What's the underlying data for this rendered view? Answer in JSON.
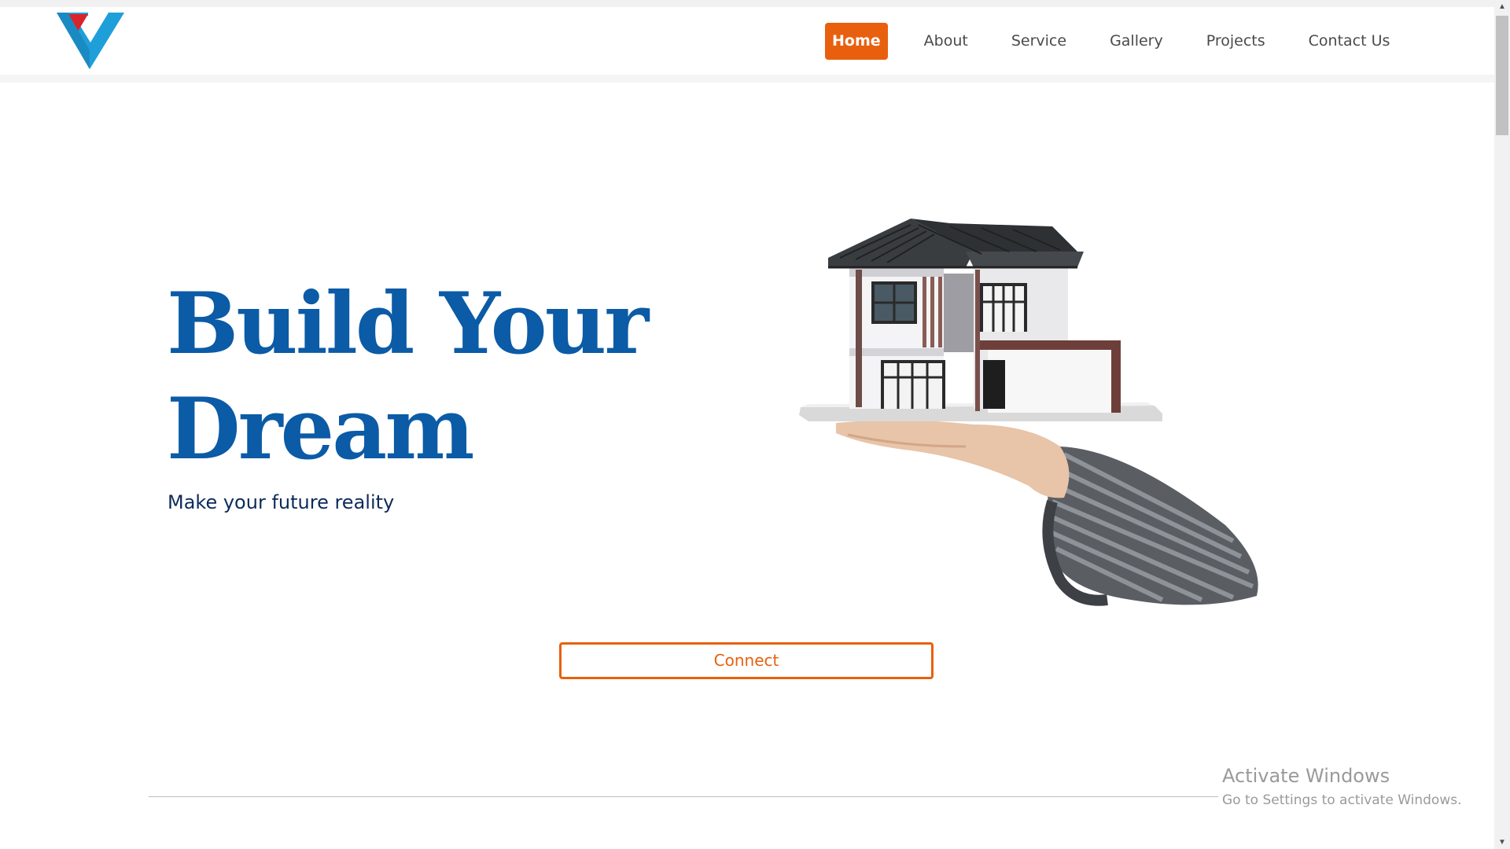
{
  "nav": {
    "items": [
      {
        "label": "Home",
        "active": true
      },
      {
        "label": "About"
      },
      {
        "label": "Service"
      },
      {
        "label": "Gallery"
      },
      {
        "label": "Projects"
      },
      {
        "label": "Contact Us"
      }
    ]
  },
  "hero": {
    "title_line1": "Build Your",
    "title_line2": "Dream",
    "subtitle": "Make your future reality",
    "image": "house-model-on-hand"
  },
  "cta": {
    "label": "Connect"
  },
  "watermark": {
    "title": "Activate Windows",
    "subtitle": "Go to Settings to activate Windows."
  },
  "colors": {
    "accent": "#e8600e",
    "title_blue": "#0b5ba6",
    "subtitle_navy": "#0c2b5a",
    "logo_blue": "#1f9fd9",
    "logo_red": "#d9252a"
  }
}
